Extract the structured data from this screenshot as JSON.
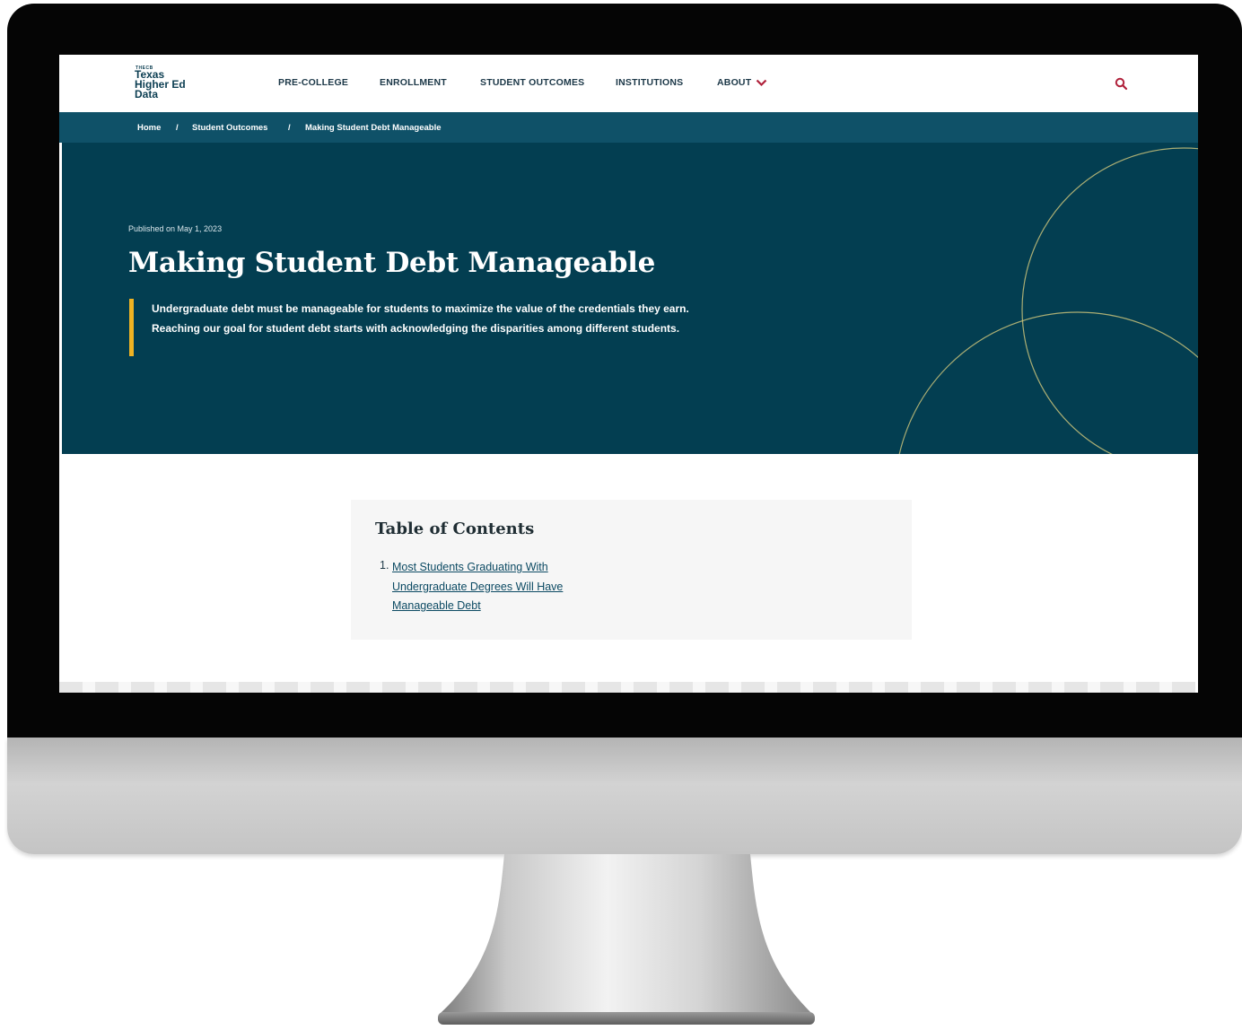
{
  "header": {
    "logo": {
      "top": "THECB",
      "line1": "Texas",
      "line2": "Higher Ed",
      "line3": "Data"
    },
    "nav": [
      {
        "label": "PRE-COLLEGE"
      },
      {
        "label": "ENROLLMENT"
      },
      {
        "label": "STUDENT OUTCOMES"
      },
      {
        "label": "INSTITUTIONS"
      },
      {
        "label": "ABOUT"
      }
    ],
    "about_icon": "chevron-down-icon",
    "search_icon": "search-icon"
  },
  "breadcrumb": {
    "items": [
      "Home",
      "Student Outcomes",
      "Making Student Debt Manageable"
    ],
    "separator": "/"
  },
  "hero": {
    "published": "Published on May 1, 2023",
    "title": "Making Student Debt Manageable",
    "lead": "Undergraduate debt must be manageable for students to maximize the value of the credentials they earn. Reaching our goal for student debt starts with acknowledging the disparities among different students."
  },
  "toc": {
    "title": "Table of Contents",
    "items": [
      {
        "number": "1.",
        "label": "Most Students Graduating With Undergraduate Degrees Will Have Manageable Debt"
      }
    ]
  },
  "colors": {
    "brand_dark": "#033e51",
    "breadcrumb_bg": "#0f5168",
    "accent_gold": "#f0b323",
    "accent_red": "#b0203a"
  }
}
